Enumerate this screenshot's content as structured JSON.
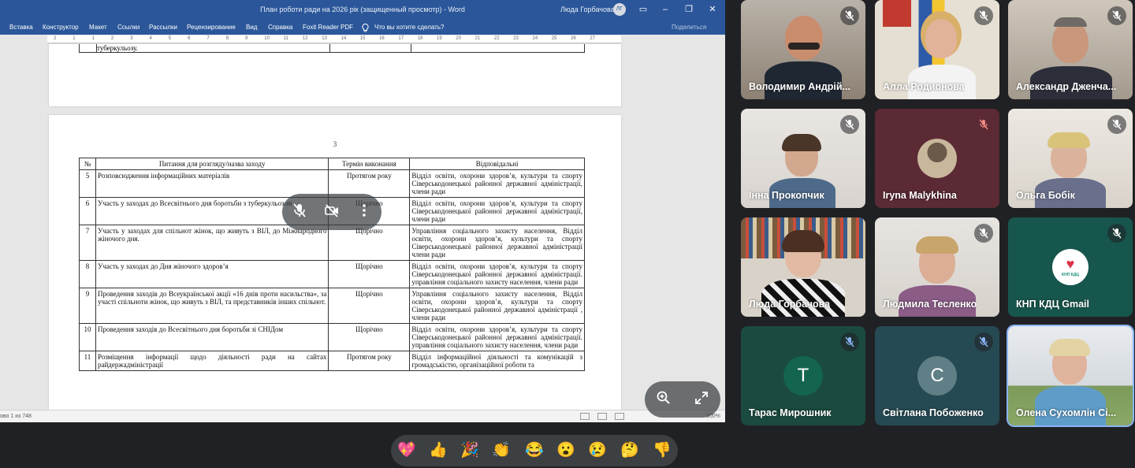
{
  "word": {
    "title": "План роботи ради на 2026 рік (защищенный просмотр)  -  Word",
    "user": "Люда Горбачова",
    "user_initials": "ЛГ",
    "window_buttons": [
      "▭",
      "–",
      "❐",
      "✕"
    ],
    "ribbon_tabs": [
      "Вставка",
      "Конструктор",
      "Макет",
      "Ссылки",
      "Рассылки",
      "Рецензирование",
      "Вид",
      "Справка",
      "Foxit Reader PDF",
      "Что вы хотите сделать?"
    ],
    "share": "Поделиться",
    "ruler_ticks": [
      "2",
      "1",
      "1",
      "2",
      "3",
      "4",
      "5",
      "6",
      "7",
      "8",
      "9",
      "10",
      "11",
      "12",
      "13",
      "14",
      "15",
      "16",
      "17",
      "18",
      "19",
      "20",
      "21",
      "22",
      "23",
      "24",
      "25",
      "26",
      "27"
    ],
    "prev_page_text": "туберкульозу.",
    "page_number": "3",
    "table": {
      "headers": [
        "№",
        "Питання для розгляду/назва заходу",
        "Термін виконання",
        "Відповідальні"
      ],
      "rows": [
        {
          "num": "5",
          "topic": "Розповсюдження інформаційних матеріалів",
          "term": "Протягом року",
          "resp": "Відділ освіти, охорони здоров’я, культури та спорту Сіверськодонецької районної державної адміністрації, члени ради"
        },
        {
          "num": "6",
          "topic": "Участь у заходах до Всесвітнього дня боротьби з туберкульозом",
          "term": "Щорічно",
          "resp": "Відділ освіти, охорони здоров’я, культури та спорту Сіверськодонецької районної державної адміністрації, члени ради"
        },
        {
          "num": "7",
          "topic": "Участь у заходах для спільнот жінок, що живуть з ВІЛ, до Міжнародного жіночого дня.",
          "term": "Щорічно",
          "resp": "Управління соціального захисту населення, Відділ освіти, охорони здоров’я, культури та спорту Сіверськодонецької районної державної адміністрації члени ради"
        },
        {
          "num": "8",
          "topic": "Участь  у заходах до Дня жіночого здоров’я",
          "term": "Щорічно",
          "resp": "Відділ освіти, охорони здоров’я, культури та спорту Сіверськодонецької районної державної адміністрації. управління соціального захисту населення, члени ради"
        },
        {
          "num": "9",
          "topic": "Проведення заходів до Всеукраїнської акції «16 днів проти насильства», за участі спільноти жінок, що живуть з ВІЛ, та представників інших спільнот.",
          "term": "Щорічно",
          "resp": "Управління соціального захисту населення, Відділ освіти, охорони здоров’я, культури та спорту Сіверськодонецької районної державної адміністрації , члени ради"
        },
        {
          "num": "10",
          "topic": "Проведення заходів до Всесвітнього дня боротьби зі СНІДом",
          "term": "Щорічно",
          "resp": "Відділ освіти, охорони здоров’я, культури та спорту Сіверськодонецької районної державної адміністрації. управління соціального захисту населення, члени ради"
        },
        {
          "num": "11",
          "topic": "Розміщення інформації щодо діяльності ради на сайтах райдержадміністрації",
          "term": "Протягом року",
          "resp": "Відділ інформаційної діяльності та комунікацій з громадськістю, організаційної роботи та"
        }
      ]
    },
    "status_words": "ово 1 из 748",
    "status_zoom": "100%"
  },
  "overlays": {
    "mute_icons": [
      "mic-off-icon",
      "camera-off-icon",
      "more-icon"
    ],
    "zoom_icons": [
      "zoom-in-icon",
      "fullscreen-icon"
    ]
  },
  "participants": [
    {
      "name": "Володимир Андрій...",
      "type": "video"
    },
    {
      "name": "Алла Родионова",
      "type": "video"
    },
    {
      "name": "Александр Дженча...",
      "type": "video"
    },
    {
      "name": "Інна Прокопчик",
      "type": "video"
    },
    {
      "name": "Iryna Malykhina",
      "type": "avatar"
    },
    {
      "name": "Ольга Бобік",
      "type": "video"
    },
    {
      "name": "Люда Горбачова",
      "type": "video"
    },
    {
      "name": "Людмила Тесленко",
      "type": "video"
    },
    {
      "name": "КНП КДЦ Gmail",
      "type": "logo",
      "logo_text": "КНП КДЦ"
    },
    {
      "name": "Тарас Мирошник",
      "type": "letter",
      "letter": "Т"
    },
    {
      "name": "Світлана Побоженко",
      "type": "letter",
      "letter": "С"
    },
    {
      "name": "Олена Сухомлін Сі...",
      "type": "video"
    }
  ],
  "reactions": [
    "💖",
    "👍",
    "🎉",
    "👏",
    "😂",
    "😮",
    "😢",
    "🤔",
    "👎"
  ],
  "colors": {
    "word_blue": "#2b579a",
    "meet_bg": "#202124",
    "tile_bg": "#3c4043",
    "accent_blue": "#8ab4f8"
  }
}
